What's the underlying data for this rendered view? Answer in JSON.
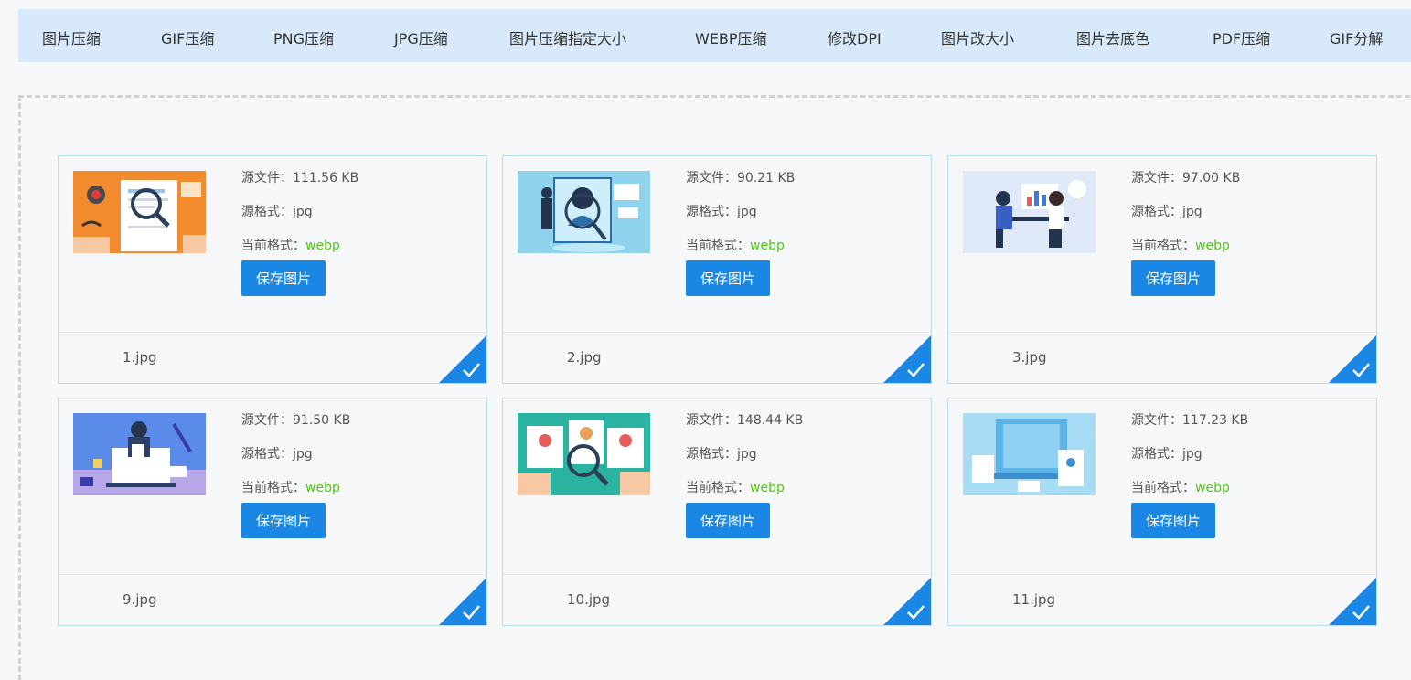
{
  "nav": {
    "items": [
      "图片压缩",
      "GIF压缩",
      "PNG压缩",
      "JPG压缩",
      "图片压缩指定大小",
      "WEBP压缩",
      "修改DPI",
      "图片改大小",
      "图片去底色",
      "PDF压缩",
      "GIF分解"
    ]
  },
  "labels": {
    "size_prefix": "源文件：",
    "src_format_prefix": "源格式：",
    "cur_format_prefix": "当前格式：",
    "save": "保存图片"
  },
  "files": [
    {
      "name": "1.jpg",
      "size": "111.56 KB",
      "src_format": "jpg",
      "cur_format": "webp"
    },
    {
      "name": "2.jpg",
      "size": "90.21 KB",
      "src_format": "jpg",
      "cur_format": "webp"
    },
    {
      "name": "3.jpg",
      "size": "97.00 KB",
      "src_format": "jpg",
      "cur_format": "webp"
    },
    {
      "name": "9.jpg",
      "size": "91.50 KB",
      "src_format": "jpg",
      "cur_format": "webp"
    },
    {
      "name": "10.jpg",
      "size": "148.44 KB",
      "src_format": "jpg",
      "cur_format": "webp"
    },
    {
      "name": "11.jpg",
      "size": "117.23 KB",
      "src_format": "jpg",
      "cur_format": "webp"
    }
  ],
  "colors": {
    "nav_bg": "#d8eaf9",
    "accent": "#1b87e5",
    "format_green": "#52c41a",
    "card_border": "#b9dcf5"
  }
}
